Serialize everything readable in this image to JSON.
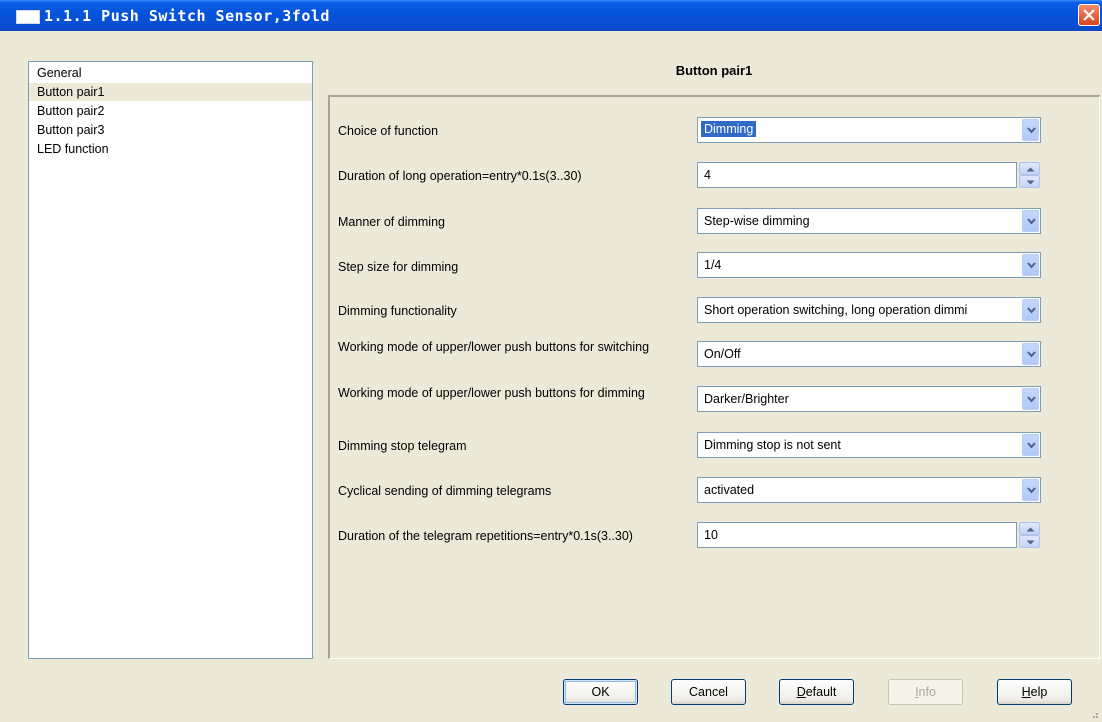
{
  "window": {
    "title": "1.1.1 Push Switch Sensor,3fold"
  },
  "sidebar": {
    "items": [
      {
        "label": "General",
        "selected": false
      },
      {
        "label": "Button pair1",
        "selected": true
      },
      {
        "label": "Button pair2",
        "selected": false
      },
      {
        "label": "Button pair3",
        "selected": false
      },
      {
        "label": "LED function",
        "selected": false
      }
    ]
  },
  "panel": {
    "title": "Button pair1",
    "rows": [
      {
        "label": "Choice of function",
        "type": "select",
        "value": "Dimming"
      },
      {
        "label": "Duration of long operation=entry*0.1s(3..30)",
        "type": "spin",
        "value": "4"
      },
      {
        "label": "Manner of dimming",
        "type": "select",
        "value": "Step-wise dimming"
      },
      {
        "label": "Step size for dimming",
        "type": "select",
        "value": "1/4"
      },
      {
        "label": "Dimming functionality",
        "type": "select",
        "value": "Short operation switching, long operation  dimmi"
      },
      {
        "label": "Working mode of upper/lower push buttons for switching",
        "type": "select",
        "value": "On/Off"
      },
      {
        "label": "Working mode of upper/lower push buttons for dimming",
        "type": "select",
        "value": "Darker/Brighter"
      },
      {
        "label": "Dimming stop telegram",
        "type": "select",
        "value": "Dimming stop is not sent"
      },
      {
        "label": "Cyclical sending of dimming telegrams",
        "type": "select",
        "value": "activated"
      },
      {
        "label": "Duration of the telegram repetitions=entry*0.1s(3..30)",
        "type": "spin",
        "value": "10"
      }
    ]
  },
  "buttons": {
    "ok": "OK",
    "cancel": "Cancel",
    "default_pre": "",
    "default_u": "D",
    "default_rest": "efault",
    "info_u": "I",
    "info_rest": "nfo",
    "help_u": "H",
    "help_rest": "elp"
  },
  "colors": {
    "titlebar": "#0553db",
    "selection": "#316ac5",
    "window_bg": "#ece9d8"
  }
}
